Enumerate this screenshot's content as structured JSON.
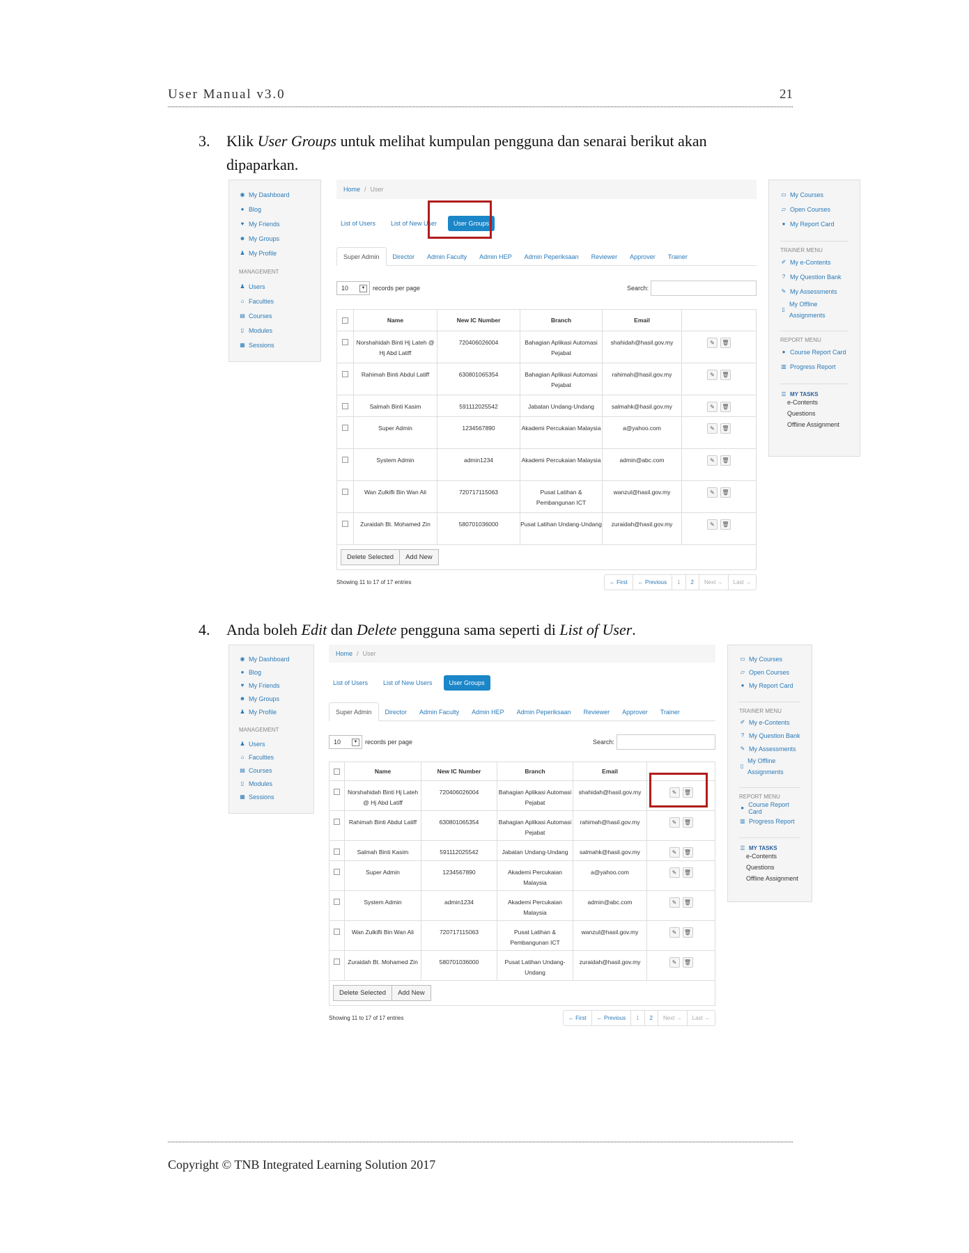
{
  "header": {
    "title": "User Manual v3.0",
    "page": "21"
  },
  "steps": [
    {
      "num": "3.",
      "line1_pre": "Klik ",
      "line1_em": "User Groups",
      "line1_post": " untuk melihat kumpulan pengguna dan senarai berikut akan",
      "line2": "dipaparkan."
    },
    {
      "num": "4.",
      "pre": "Anda boleh ",
      "em1": "Edit",
      "mid1": " dan ",
      "em2": "Delete",
      "mid2": " pengguna sama seperti di ",
      "em3": "List of User",
      "post": "."
    }
  ],
  "left_nav": {
    "items": [
      "My Dashboard",
      "Blog",
      "My Friends",
      "My Groups",
      "My Profile"
    ],
    "management_title": "MANAGEMENT",
    "management": [
      "Users",
      "Faculties",
      "Courses",
      "Modules",
      "Sessions"
    ]
  },
  "right_nav": {
    "items": [
      "My Courses",
      "Open Courses",
      "My Report Card"
    ],
    "trainer_title": "TRAINER MENU",
    "trainer": [
      "My e-Contents",
      "My Question Bank",
      "My Assessments",
      "My Offline Assignments"
    ],
    "report_title": "REPORT MENU",
    "report": [
      "Course Report Card",
      "Progress Report"
    ],
    "tasks_title": "MY TASKS",
    "tasks": [
      "e-Contents",
      "Questions",
      "Offline Assignment"
    ]
  },
  "breadcrumb": {
    "home": "Home",
    "sep": "/",
    "current": "User"
  },
  "pills_1": [
    "List of Users",
    "List of New User",
    "User Groups"
  ],
  "pills_2": [
    "List of Users",
    "List of New Users",
    "User Groups"
  ],
  "tabs": [
    "Super Admin",
    "Director",
    "Admin Faculty",
    "Admin HEP",
    "Admin Peperiksaan",
    "Reviewer",
    "Approver",
    "Trainer"
  ],
  "controls": {
    "records_value": "10",
    "records_label": "records per page",
    "search_label": "Search:"
  },
  "table": {
    "columns": [
      "Name",
      "New IC Number",
      "Branch",
      "Email"
    ],
    "rows": [
      [
        "Norshahidah Binti Hj Lateh @ Hj Abd Latiff",
        "720406026004",
        "Bahagian Aplikasi Automasi Pejabat",
        "shahidah@hasil.gov.my"
      ],
      [
        "Rahimah Binti Abdul Latiff",
        "630801065354",
        "Bahagian Aplikasi Automasi Pejabat",
        "rahimah@hasil.gov.my"
      ],
      [
        "Salmah Binti Kasim",
        "591112025542",
        "Jabatan Undang-Undang",
        "salmahk@hasil.gov.my"
      ],
      [
        "Super Admin",
        "1234567890",
        "Akademi Percukaian Malaysia",
        "a@yahoo.com"
      ],
      [
        "System Admin",
        "admin1234",
        "Akademi Percukaian Malaysia",
        "admin@abc.com"
      ],
      [
        "Wan Zulkifli Bin Wan Ali",
        "720717115063",
        "Pusat Latihan & Pembangunan ICT",
        "wanzul@hasil.gov.my"
      ],
      [
        "Zuraidah Bt. Mohamed Zin",
        "580701036000",
        "Pusat Latihan Undang-Undang",
        "zuraidah@hasil.gov.my"
      ]
    ],
    "delete_label": "Delete Selected",
    "add_label": "Add New"
  },
  "pagination": {
    "info": "Showing 11 to 17 of 17 entries",
    "first": "← First",
    "prev": "← Previous",
    "p1": "1",
    "p2": "2",
    "next": "Next →",
    "last": "Last →"
  },
  "icons": {
    "edit": "✎",
    "delete": "🗑"
  },
  "colors": {
    "link": "#2a7ab8",
    "active_pill": "#1b86c8",
    "highlight": "#b01c1c"
  },
  "footer": "Copyright © TNB Integrated Learning Solution 2017"
}
